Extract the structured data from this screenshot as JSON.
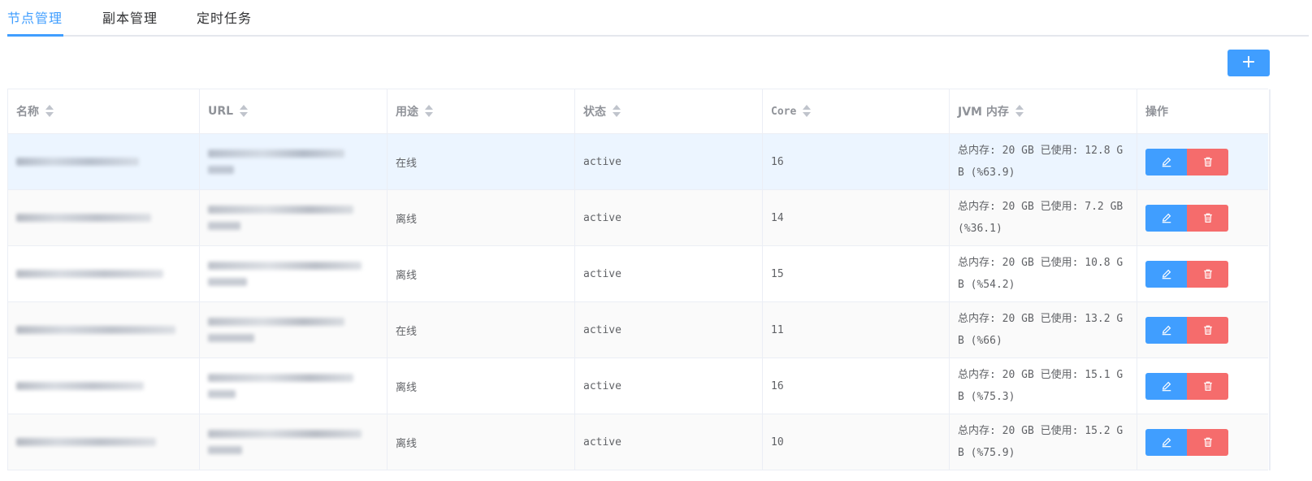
{
  "tabs": [
    {
      "label": "节点管理",
      "active": true
    },
    {
      "label": "副本管理",
      "active": false
    },
    {
      "label": "定时任务",
      "active": false
    }
  ],
  "toolbar": {
    "add_label": "+"
  },
  "colors": {
    "primary": "#409eff",
    "danger": "#f56c6c",
    "header_text": "#909399"
  },
  "table": {
    "headers": [
      "名称",
      "URL",
      "用途",
      "状态",
      "Core",
      "JVM 内存",
      "操作"
    ],
    "rows": [
      {
        "usage": "在线",
        "status": "active",
        "core": "16",
        "jvm_memory": "总内存: 20 GB 已使用: 12.8 GB (%63.9)"
      },
      {
        "usage": "离线",
        "status": "active",
        "core": "14",
        "jvm_memory": "总内存: 20 GB 已使用: 7.2 GB (%36.1)"
      },
      {
        "usage": "离线",
        "status": "active",
        "core": "15",
        "jvm_memory": "总内存: 20 GB 已使用: 10.8 GB (%54.2)"
      },
      {
        "usage": "在线",
        "status": "active",
        "core": "11",
        "jvm_memory": "总内存: 20 GB 已使用: 13.2 GB (%66)"
      },
      {
        "usage": "离线",
        "status": "active",
        "core": "16",
        "jvm_memory": "总内存: 20 GB 已使用: 15.1 GB (%75.3)"
      },
      {
        "usage": "离线",
        "status": "active",
        "core": "10",
        "jvm_memory": "总内存: 20 GB 已使用: 15.2 GB (%75.9)"
      }
    ],
    "action_icons": {
      "edit": "edit-icon",
      "delete": "trash-icon"
    }
  }
}
